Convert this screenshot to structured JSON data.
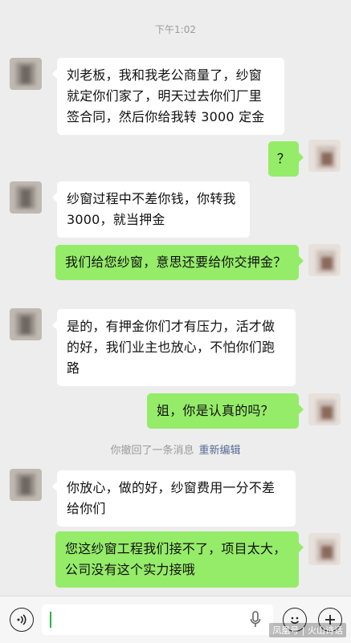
{
  "chat": {
    "timestamp": "下午1:02",
    "messages": [
      {
        "side": "left",
        "text": "刘老板，我和我老公商量了，纱窗就定你们家了，明天过去你们厂里签合同，然后你给我转 3000 定金"
      },
      {
        "side": "right",
        "text": "？"
      },
      {
        "side": "left",
        "text": "纱窗过程中不差你钱，你转我3000，就当押金"
      },
      {
        "side": "right",
        "text": "我们给您纱窗，意思还要给你交押金？"
      },
      {
        "side": "left",
        "text": "是的，有押金你们才有压力，活才做的好，我们业主也放心，不怕你们跑路"
      },
      {
        "side": "right",
        "text": "姐，你是认真的吗？"
      },
      {
        "side": "left",
        "text": "你放心，做的好，纱窗费用一分不差给你们"
      },
      {
        "side": "right",
        "text": "您这纱窗工程我们接不了，项目太大，公司没有这个实力接哦"
      }
    ],
    "recall_notice": "你撤回了一条消息",
    "re_edit_label": "重新编辑"
  },
  "input_bar": {
    "voice_icon": "voice-icon",
    "mic_icon": "microphone-icon",
    "emoji_icon": "emoji-icon",
    "plus_icon": "plus-icon"
  },
  "watermark": "凤凰号 | 火山诗话"
}
